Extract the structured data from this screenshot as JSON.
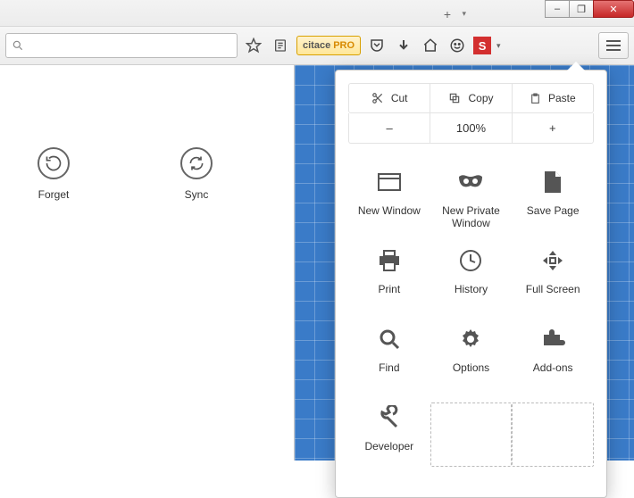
{
  "window": {
    "minimize": "–",
    "maximize": "❐",
    "close": "✕",
    "new_tab_plus": "+",
    "new_tab_caret": "▾"
  },
  "toolbar": {
    "url_value": "",
    "url_placeholder": "",
    "citace_label": "citace",
    "citace_suffix": "PRO",
    "s_icon_label": "S",
    "s_caret": "▾"
  },
  "left_panel": {
    "items": [
      {
        "label": "Forget",
        "icon": "history-back-icon"
      },
      {
        "label": "Sync",
        "icon": "sync-icon"
      }
    ]
  },
  "menu": {
    "clip": {
      "cut": "Cut",
      "copy": "Copy",
      "paste": "Paste"
    },
    "zoom": {
      "minus": "–",
      "level": "100%",
      "plus": "+"
    },
    "items": [
      {
        "label": "New Window"
      },
      {
        "label": "New Private Window"
      },
      {
        "label": "Save Page"
      },
      {
        "label": "Print"
      },
      {
        "label": "History"
      },
      {
        "label": "Full Screen"
      },
      {
        "label": "Find"
      },
      {
        "label": "Options"
      },
      {
        "label": "Add-ons"
      },
      {
        "label": "Developer"
      }
    ]
  }
}
